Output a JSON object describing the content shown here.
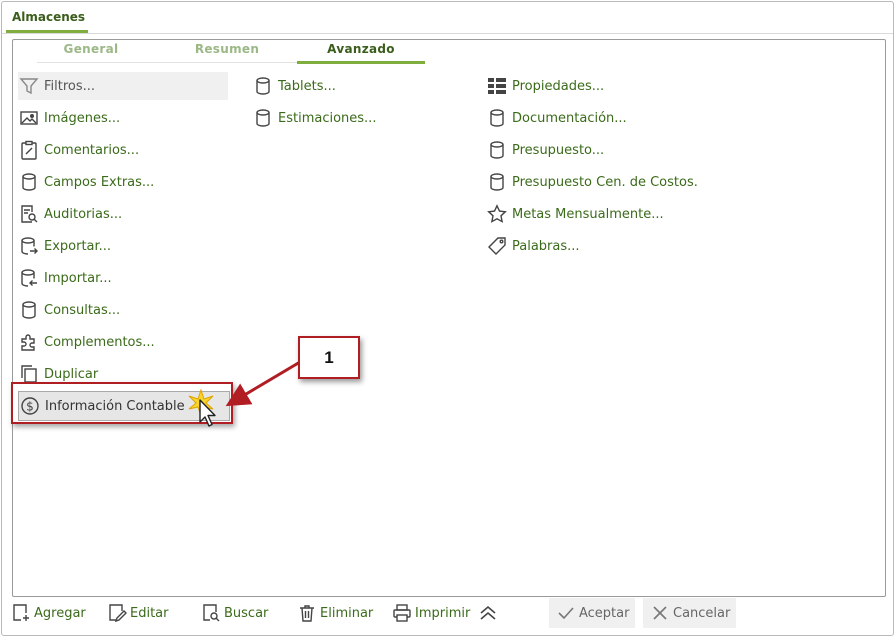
{
  "window": {
    "title": "Almacenes"
  },
  "subtabs": [
    {
      "label": "General"
    },
    {
      "label": "Resumen"
    },
    {
      "label": "Avanzado"
    }
  ],
  "columns": {
    "col1": [
      {
        "label": "Filtros...",
        "icon": "filter-icon"
      },
      {
        "label": "Imágenes...",
        "icon": "image-icon"
      },
      {
        "label": "Comentarios...",
        "icon": "clipboard-edit-icon"
      },
      {
        "label": "Campos Extras...",
        "icon": "database-icon"
      },
      {
        "label": "Auditorias...",
        "icon": "audit-search-icon"
      },
      {
        "label": "Exportar...",
        "icon": "database-export-icon"
      },
      {
        "label": "Importar...",
        "icon": "database-import-icon"
      },
      {
        "label": "Consultas...",
        "icon": "database-icon"
      },
      {
        "label": "Complementos...",
        "icon": "puzzle-icon"
      },
      {
        "label": "Duplicar",
        "icon": "copy-icon"
      },
      {
        "label": "Información Contable",
        "icon": "dollar-circle-icon"
      }
    ],
    "col2": [
      {
        "label": "Tablets...",
        "icon": "database-icon"
      },
      {
        "label": "Estimaciones...",
        "icon": "database-icon"
      }
    ],
    "col3": [
      {
        "label": "Propiedades...",
        "icon": "properties-grid-icon"
      },
      {
        "label": "Documentación...",
        "icon": "database-icon"
      },
      {
        "label": "Presupuesto...",
        "icon": "database-icon"
      },
      {
        "label": "Presupuesto Cen. de Costos.",
        "icon": "database-icon"
      },
      {
        "label": "Metas Mensualmente...",
        "icon": "star-icon"
      },
      {
        "label": "Palabras...",
        "icon": "tag-icon"
      }
    ]
  },
  "callout": {
    "number": "1"
  },
  "toolbar": {
    "agregar": "Agregar",
    "editar": "Editar",
    "buscar": "Buscar",
    "eliminar": "Eliminar",
    "imprimir": "Imprimir",
    "aceptar": "Aceptar",
    "cancelar": "Cancelar"
  },
  "colors": {
    "accent_green": "#7fae3e",
    "link_green": "#3b6b1a",
    "annotation_red": "#b01e24"
  }
}
